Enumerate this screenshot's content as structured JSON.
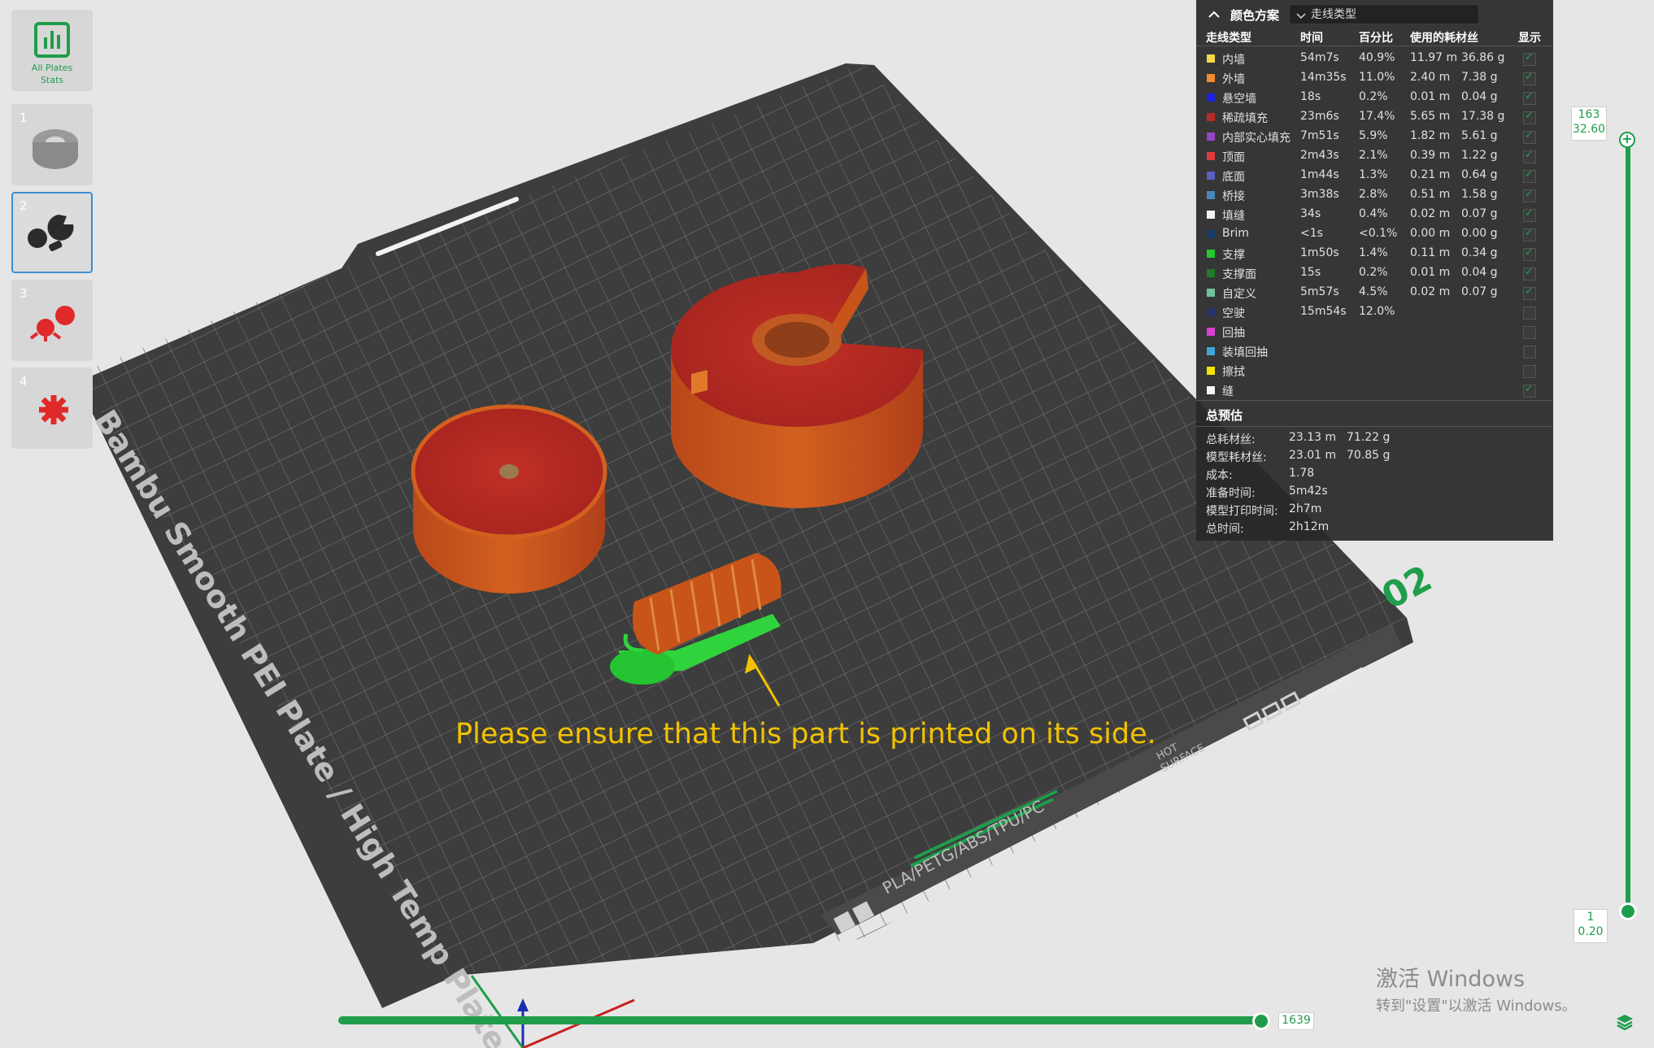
{
  "plates": {
    "stats_button_label_1": "All Plates",
    "stats_button_label_2": "Stats",
    "thumbs": [
      {
        "number": "1"
      },
      {
        "number": "2"
      },
      {
        "number": "3"
      },
      {
        "number": "4"
      }
    ]
  },
  "panel": {
    "scheme_label": "颜色方案",
    "scheme_value": "走线类型",
    "columns": {
      "type": "走线类型",
      "time": "时间",
      "percent": "百分比",
      "filament": "使用的耗材丝",
      "show": "显示"
    },
    "rows": [
      {
        "name": "内墙",
        "time": "54m7s",
        "percent": "40.9%",
        "length": "11.97 m",
        "weight": "36.86 g",
        "color": "#f5d848",
        "shown": true
      },
      {
        "name": "外墙",
        "time": "14m35s",
        "percent": "11.0%",
        "length": "2.40 m",
        "weight": "7.38 g",
        "color": "#f28a2e",
        "shown": true
      },
      {
        "name": "悬空墙",
        "time": "18s",
        "percent": "0.2%",
        "length": "0.01 m",
        "weight": "0.04 g",
        "color": "#1b23e0",
        "shown": true
      },
      {
        "name": "稀疏填充",
        "time": "23m6s",
        "percent": "17.4%",
        "length": "5.65 m",
        "weight": "17.38 g",
        "color": "#b52b2b",
        "shown": true
      },
      {
        "name": "内部实心填充",
        "time": "7m51s",
        "percent": "5.9%",
        "length": "1.82 m",
        "weight": "5.61 g",
        "color": "#9545c8",
        "shown": true
      },
      {
        "name": "顶面",
        "time": "2m43s",
        "percent": "2.1%",
        "length": "0.39 m",
        "weight": "1.22 g",
        "color": "#e23b3b",
        "shown": true
      },
      {
        "name": "底面",
        "time": "1m44s",
        "percent": "1.3%",
        "length": "0.21 m",
        "weight": "0.64 g",
        "color": "#5a5fc4",
        "shown": true
      },
      {
        "name": "桥接",
        "time": "3m38s",
        "percent": "2.8%",
        "length": "0.51 m",
        "weight": "1.58 g",
        "color": "#4a86b8",
        "shown": true
      },
      {
        "name": "填缝",
        "time": "34s",
        "percent": "0.4%",
        "length": "0.02 m",
        "weight": "0.07 g",
        "color": "#f2f2f2",
        "shown": true
      },
      {
        "name": "Brim",
        "time": "<1s",
        "percent": "<0.1%",
        "length": "0.00 m",
        "weight": "0.00 g",
        "color": "#133a6b",
        "shown": true
      },
      {
        "name": "支撑",
        "time": "1m50s",
        "percent": "1.4%",
        "length": "0.11 m",
        "weight": "0.34 g",
        "color": "#22c92f",
        "shown": true
      },
      {
        "name": "支撑面",
        "time": "15s",
        "percent": "0.2%",
        "length": "0.01 m",
        "weight": "0.04 g",
        "color": "#1f7a2a",
        "shown": true
      },
      {
        "name": "自定义",
        "time": "5m57s",
        "percent": "4.5%",
        "length": "0.02 m",
        "weight": "0.07 g",
        "color": "#6fc39a",
        "shown": true
      },
      {
        "name": "空驶",
        "time": "15m54s",
        "percent": "12.0%",
        "length": "",
        "weight": "",
        "color": "#27306b",
        "shown": false
      },
      {
        "name": "回抽",
        "time": "",
        "percent": "",
        "length": "",
        "weight": "",
        "color": "#d83fd0",
        "shown": false
      },
      {
        "name": "装填回抽",
        "time": "",
        "percent": "",
        "length": "",
        "weight": "",
        "color": "#3fa6d6",
        "shown": false
      },
      {
        "name": "擦拭",
        "time": "",
        "percent": "",
        "length": "",
        "weight": "",
        "color": "#f2e600",
        "shown": false
      },
      {
        "name": "缝",
        "time": "",
        "percent": "",
        "length": "",
        "weight": "",
        "color": "#f5f5f5",
        "shown": true
      }
    ],
    "summary_title": "总预估",
    "summary": [
      {
        "label": "总耗材丝:",
        "v1": "23.13 m",
        "v2": "71.22 g"
      },
      {
        "label": "模型耗材丝:",
        "v1": "23.01 m",
        "v2": "70.85 g"
      },
      {
        "label": "成本:",
        "v1": "1.78",
        "v2": ""
      },
      {
        "label": "准备时间:",
        "v1": "5m42s",
        "v2": ""
      },
      {
        "label": "模型打印时间:",
        "v1": "2h7m",
        "v2": ""
      },
      {
        "label": "总时间:",
        "v1": "2h12m",
        "v2": ""
      }
    ]
  },
  "vslider": {
    "top_layer": "163",
    "top_height": "32.60",
    "bottom_layer": "1",
    "bottom_height": "0.20"
  },
  "hslider": {
    "value": "1639"
  },
  "plate_texts": {
    "brand": "Bambu Smooth PEI Plate / High Temp Plate",
    "materials": "PLA/PETG/ABS/TPU/PC",
    "hot_surface_1": "HOT",
    "hot_surface_2": "SURFACE",
    "plate_number": "02"
  },
  "notice": "Please ensure that this part is printed on its side.",
  "watermark": {
    "line1": "激活 Windows",
    "line2": "转到\"设置\"以激活 Windows。"
  },
  "colors": {
    "accent_green": "#1f9d4b",
    "notice_yellow": "#f2c200",
    "bed": "#3e3e3e",
    "print_orange": "#c8541a",
    "print_red": "#b82a22"
  }
}
